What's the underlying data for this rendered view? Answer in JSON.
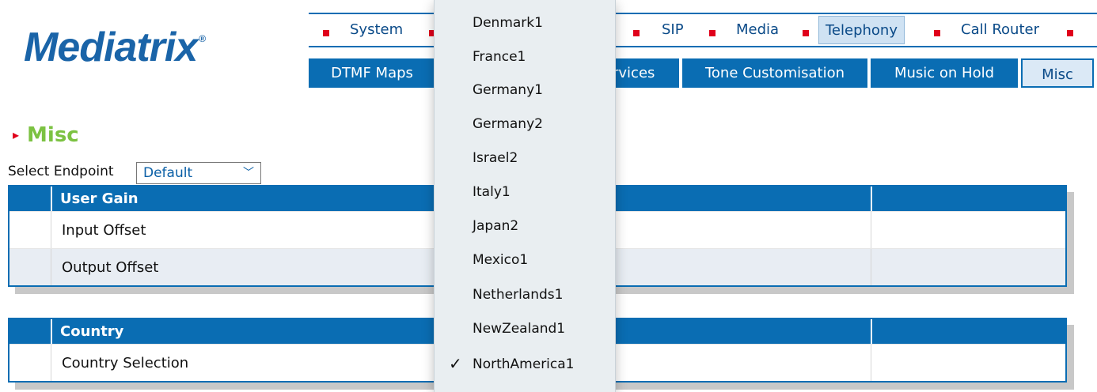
{
  "logo": {
    "text": "Mediatrix",
    "reg": "®"
  },
  "top_nav": [
    "System",
    "SIP",
    "Media",
    "Telephony",
    "Call Router"
  ],
  "top_nav_active": "Telephony",
  "sub_nav": {
    "dtmf": "DTMF Maps",
    "services_partial": "rvices",
    "tone": "Tone Customisation",
    "music": "Music on Hold",
    "misc": "Misc"
  },
  "page": {
    "title": "Misc"
  },
  "endpoint": {
    "label": "Select Endpoint",
    "value": "Default"
  },
  "user_gain": {
    "title": "User Gain",
    "rows": [
      "Input Offset",
      "Output Offset"
    ]
  },
  "country": {
    "title": "Country",
    "rows": [
      "Country Selection"
    ]
  },
  "dropdown": {
    "options": [
      "Denmark1",
      "France1",
      "Germany1",
      "Germany2",
      "Israel2",
      "Italy1",
      "Japan2",
      "Mexico1",
      "Netherlands1",
      "NewZealand1",
      "NorthAmerica1"
    ],
    "selected": "NorthAmerica1"
  },
  "colors": {
    "brand_blue": "#0a6db3",
    "accent_red": "#e0001b",
    "title_green": "#7cc242"
  }
}
